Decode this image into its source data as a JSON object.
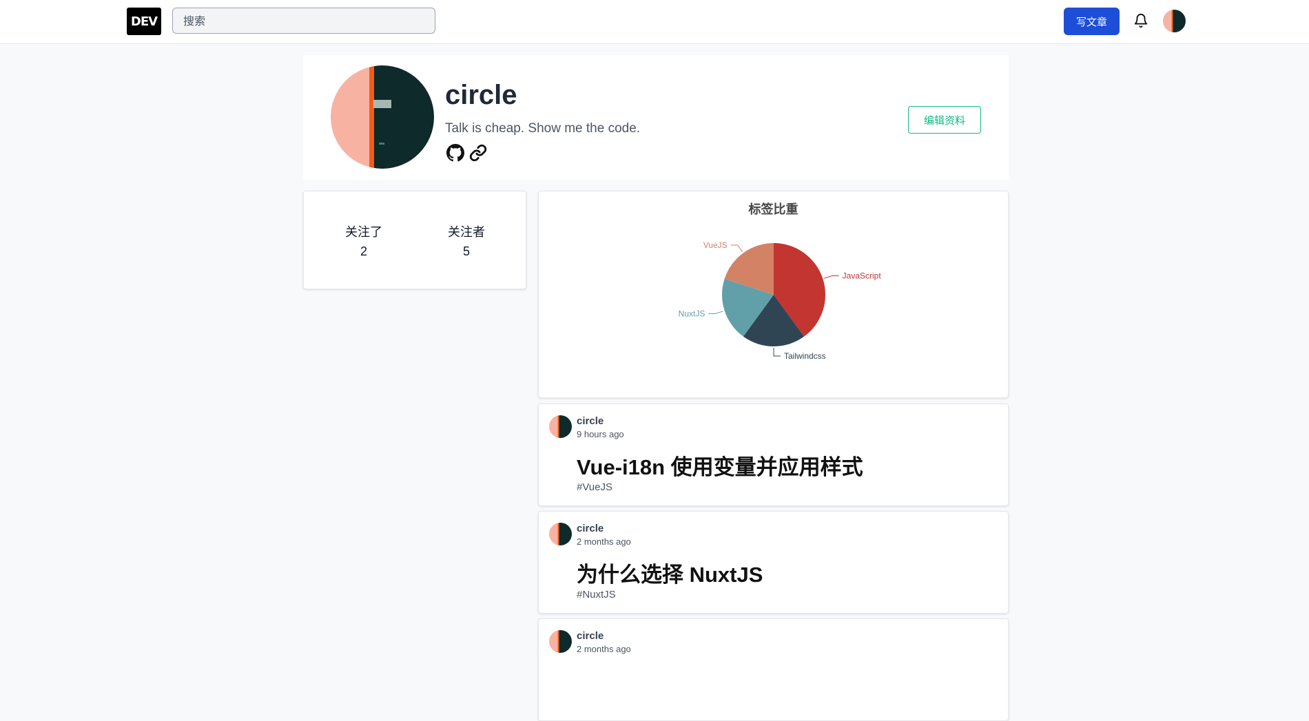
{
  "navbar": {
    "logo": "DEV",
    "search_placeholder": "搜索",
    "write_label": "写文章"
  },
  "profile": {
    "name": "circle",
    "bio": "Talk is cheap. Show me the code.",
    "edit_label": "编辑资料"
  },
  "stats": [
    {
      "label": "关注了",
      "value": "2"
    },
    {
      "label": "关注者",
      "value": "5"
    }
  ],
  "chart_data": {
    "type": "pie",
    "title": "标签比重",
    "slices": [
      {
        "label": "JavaScript",
        "value": 2,
        "color": "#c23531"
      },
      {
        "label": "Tailwindcss",
        "value": 1,
        "color": "#2f4554"
      },
      {
        "label": "NuxtJS",
        "value": 1,
        "color": "#61a0a8"
      },
      {
        "label": "VueJS",
        "value": 1,
        "color": "#d48265"
      }
    ]
  },
  "articles": [
    {
      "author": "circle",
      "time": "9 hours ago",
      "title": "Vue-i18n 使用变量并应用样式",
      "tag": "#VueJS"
    },
    {
      "author": "circle",
      "time": "2 months ago",
      "title": "为什么选择 NuxtJS",
      "tag": "#NuxtJS"
    },
    {
      "author": "circle",
      "time": "2 months ago",
      "title": "",
      "tag": ""
    }
  ],
  "colors": {
    "accent": "#1d4ed8",
    "edit": "#10b981",
    "avatar_left": "#f8b2a2",
    "avatar_stripe": "#f25c19",
    "avatar_right": "#0e2a2a"
  },
  "icons": [
    "bell-icon",
    "github-icon",
    "link-icon",
    "avatar-image"
  ]
}
